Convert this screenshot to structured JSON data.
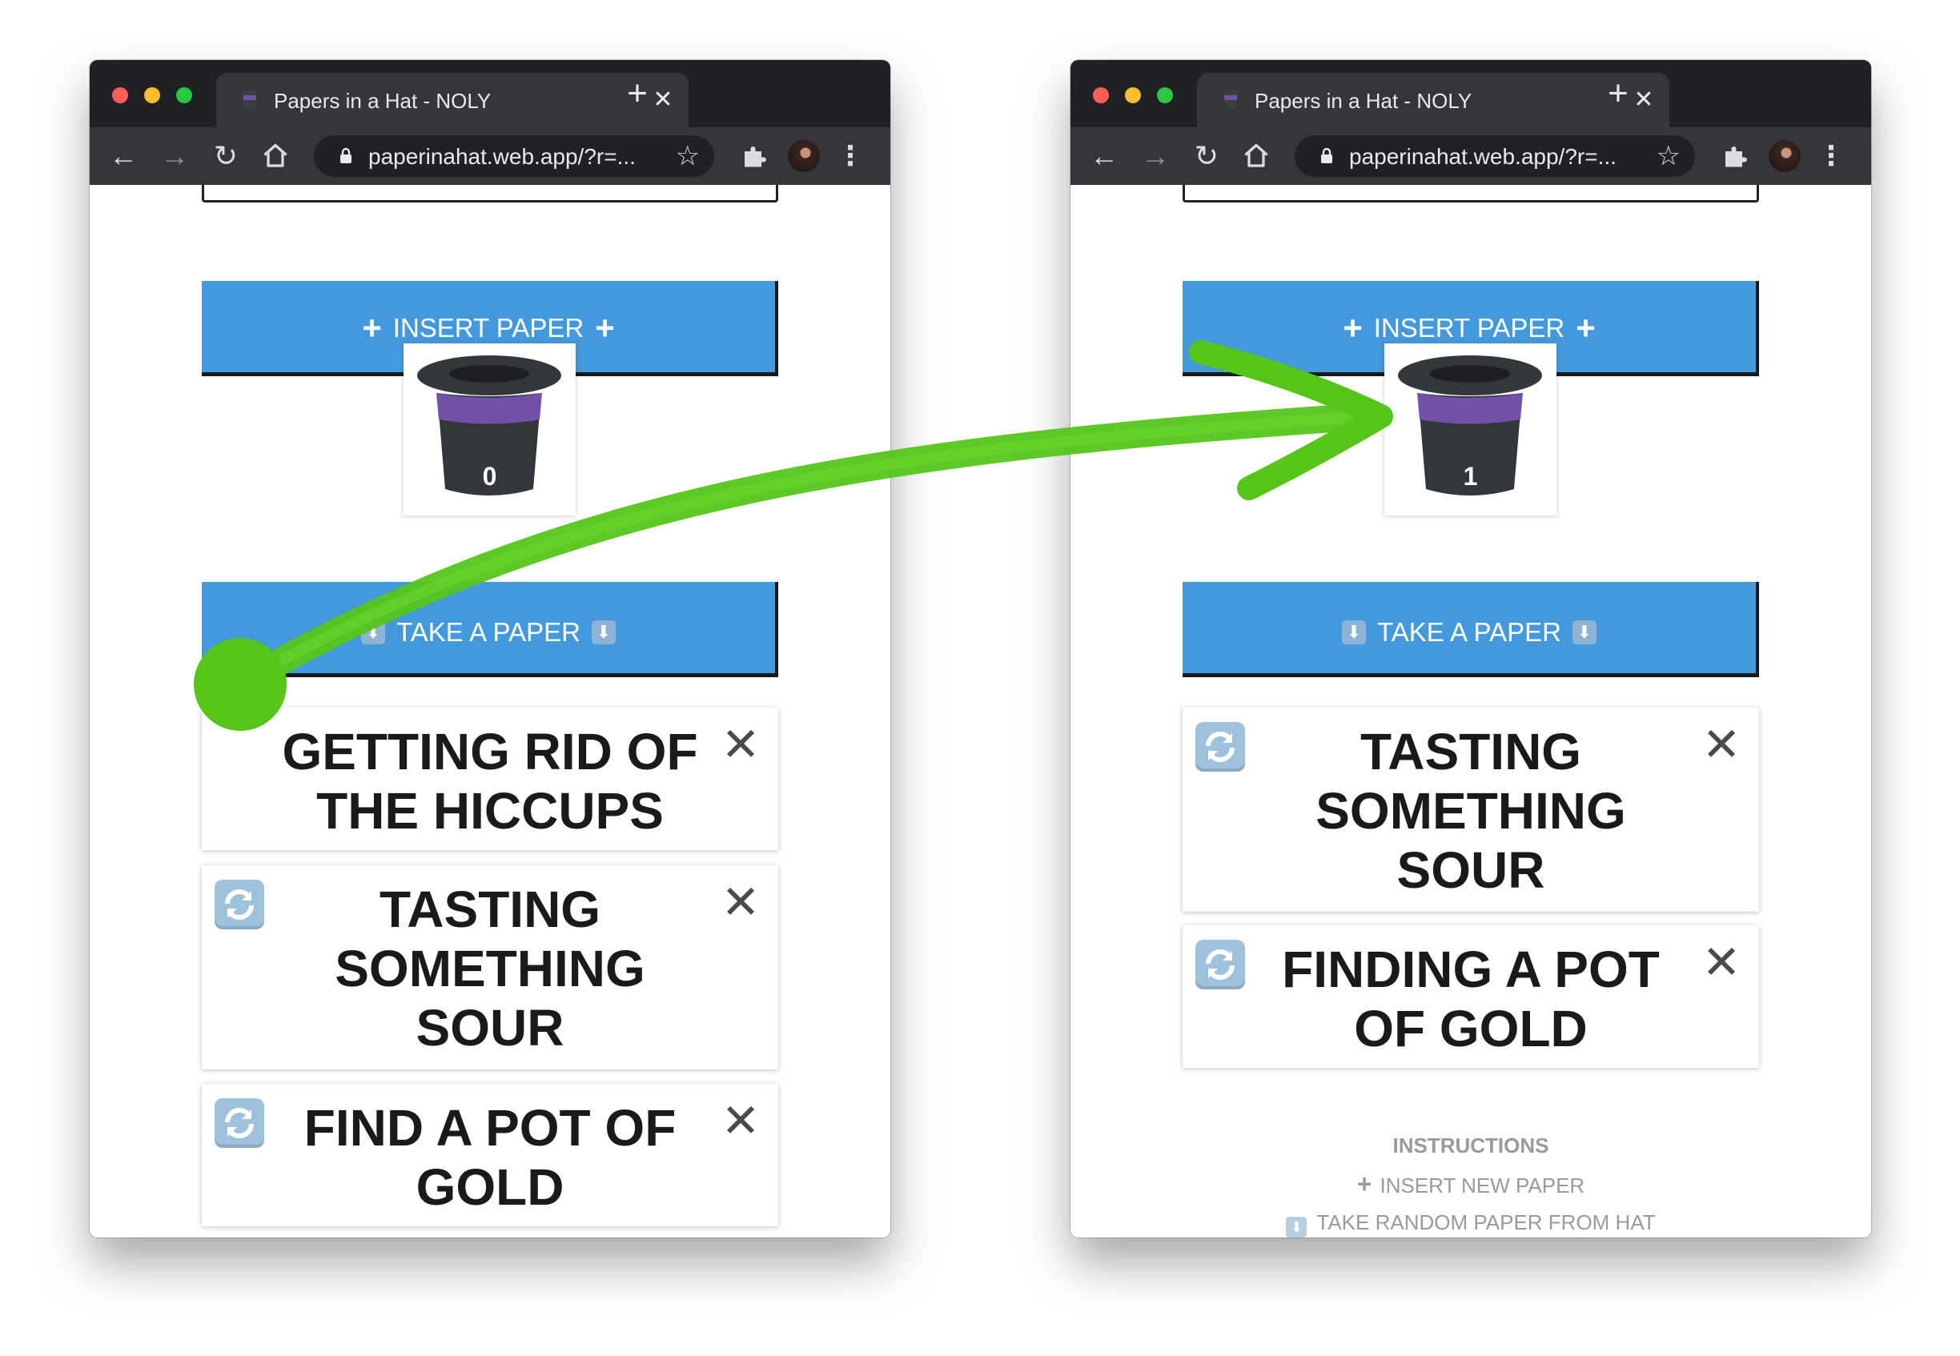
{
  "windows": {
    "left": {
      "tab_title": "Papers in a Hat - NOLY",
      "url": "paperinahat.web.app/?r=...",
      "insert_label": "INSERT PAPER",
      "take_label": "TAKE A PAPER",
      "hat_count": "0",
      "papers": [
        {
          "text": "GETTING RID OF THE HICCUPS"
        },
        {
          "text": "TASTING SOMETHING SOUR"
        },
        {
          "text": "FIND A POT OF GOLD"
        }
      ]
    },
    "right": {
      "tab_title": "Papers in a Hat - NOLY",
      "url": "paperinahat.web.app/?r=...",
      "insert_label": "INSERT PAPER",
      "take_label": "TAKE A PAPER",
      "hat_count": "1",
      "papers": [
        {
          "text": "TASTING SOMETHING SOUR"
        },
        {
          "text": "FINDING A POT OF GOLD"
        }
      ],
      "instructions": {
        "title": "INSTRUCTIONS",
        "insert": "INSERT NEW PAPER",
        "take": "TAKE RANDOM PAPER FROM HAT"
      }
    }
  },
  "colors": {
    "button": "#4499dd",
    "hat_band": "#7052a8",
    "hat_body": "#33363b",
    "arrow": "#55c51a"
  },
  "icons": {
    "insert": "plus-icon",
    "take": "down-arrow-box-icon",
    "paper_action": "refresh-icon",
    "paper_remove": "close-icon"
  }
}
